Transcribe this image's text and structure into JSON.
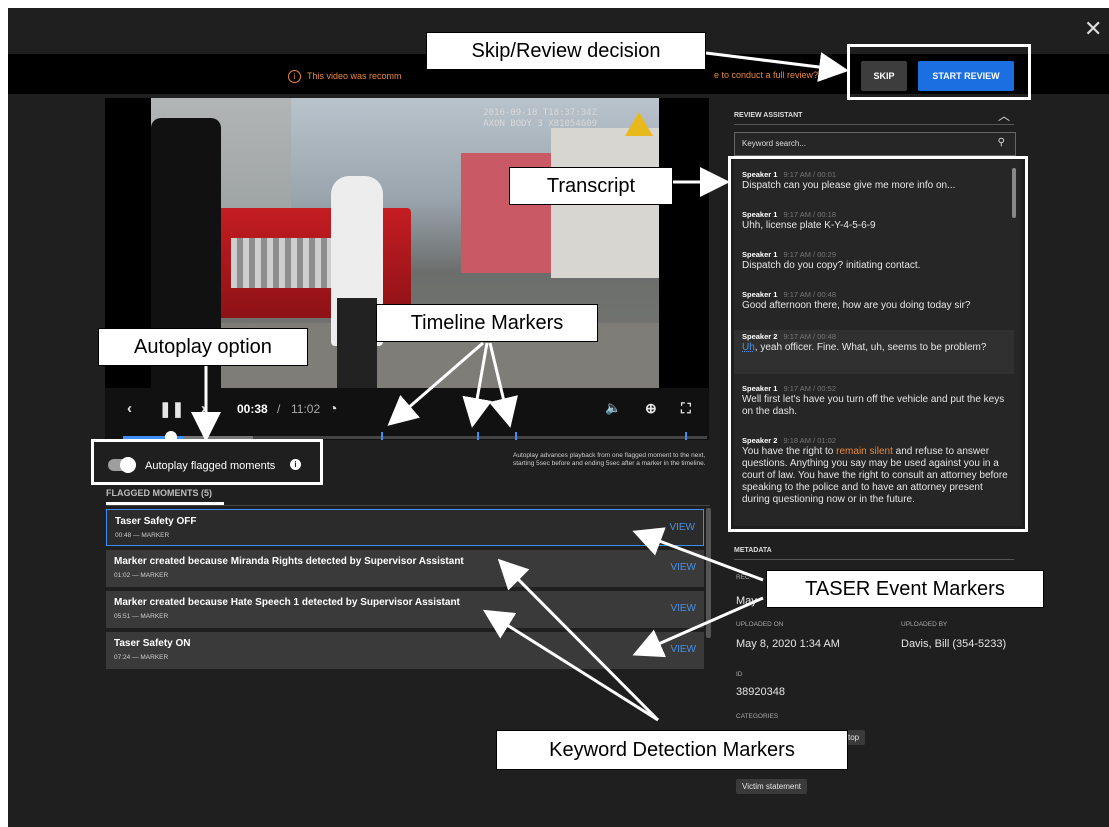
{
  "close_label": "✕",
  "banner": {
    "icon": "info-circle-icon",
    "text_left": "This video was recomm",
    "text_right": "e to conduct a full review?",
    "skip_label": "SKIP",
    "start_label": "START REVIEW",
    "accent": "#1b6fe0"
  },
  "video": {
    "osd_line1": "2016-09-18 T18:37:34Z",
    "osd_line2": "AXON BODY 3 X81054609",
    "current_time": "00:38",
    "separator": "/",
    "total_time": "11:02",
    "progress_fraction": 0.057
  },
  "autoplay": {
    "label": "Autoplay flagged moments",
    "description": "Autoplay advances playback from one flagged moment to the next, starting 5sec before and ending 5sec after a marker in the timeline."
  },
  "flagged": {
    "tab_label": "FLAGGED MOMENTS (5)",
    "view_label": "VIEW",
    "rows": [
      {
        "title": "Taser Safety OFF",
        "sub": "00:48 — MARKER"
      },
      {
        "title": "Marker created because Miranda Rights detected by Supervisor Assistant",
        "sub": "01:02 — MARKER"
      },
      {
        "title": "Marker created because Hate Speech 1 detected by Supervisor Assistant",
        "sub": "05:51 — MARKER"
      },
      {
        "title": "Taser Safety ON",
        "sub": "07:24 — MARKER"
      }
    ]
  },
  "review_assistant": {
    "title": "REVIEW ASSISTANT",
    "search_placeholder": "Keyword search...",
    "transcript": [
      {
        "speaker": "Speaker 1",
        "time": "9:17 AM / 00:01",
        "text": "Dispatch can you please give me more info on..."
      },
      {
        "speaker": "Speaker 1",
        "time": "9:17 AM / 00:18",
        "text": "Uhh, license plate K-Y-4-5-6-9"
      },
      {
        "speaker": "Speaker 1",
        "time": "9:17 AM / 00:29",
        "text": "Dispatch do you copy? initiating contact."
      },
      {
        "speaker": "Speaker 1",
        "time": "9:17 AM / 00:48",
        "text": "Good afternoon there, how are you doing today sir?"
      },
      {
        "speaker": "Speaker 2",
        "time": "9:17 AM / 00:48",
        "kw": "Uh",
        "text": ", yeah officer. Fine. What, uh, seems to be problem?"
      },
      {
        "speaker": "Speaker 1",
        "time": "9:17 AM / 00:52",
        "text": "Well first let's have you turn off the vehicle and put the keys on the dash."
      },
      {
        "speaker": "Speaker 2",
        "time": "9:18 AM / 01:02",
        "pre": "You have the right to ",
        "kw": "remain silent",
        "post": " and refuse to answer questions. Anything you say may be used against you in a court of law. You have the right to consult an attorney before speaking to the police and to have an attorney present during questioning now or in the future."
      }
    ]
  },
  "metadata": {
    "title": "METADATA",
    "partial_label": "REC",
    "partial_value": "May",
    "uploaded_on_label": "UPLOADED ON",
    "uploaded_on": "May 8, 2020 1:34 AM",
    "uploaded_by_label": "UPLOADED BY",
    "uploaded_by": "Davis, Bill (354-5233)",
    "id_label": "ID",
    "id": "38920348",
    "categories_label": "CATEGORIES",
    "category_partial": "stop",
    "category_2": "Victim statement"
  },
  "annotations": {
    "skip_review": "Skip/Review decision",
    "transcript": "Transcript",
    "timeline_markers": "Timeline Markers",
    "autoplay_option": "Autoplay option",
    "taser_markers": "TASER Event Markers",
    "keyword_markers": "Keyword Detection Markers"
  }
}
